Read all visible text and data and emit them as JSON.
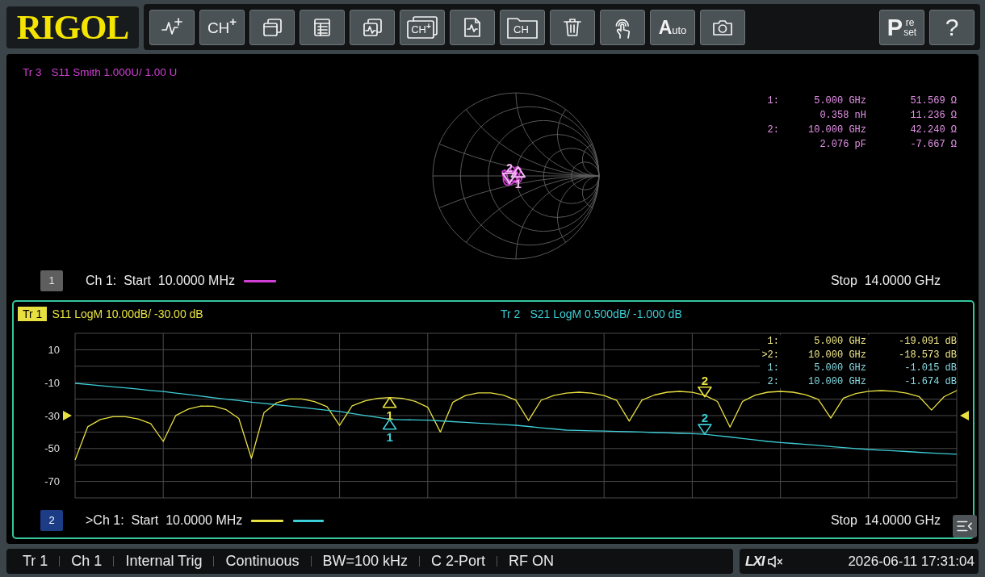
{
  "logo": {
    "text": "RIGOL"
  },
  "toolbar": {
    "left": [
      {
        "kind": "icon"
      },
      {
        "kind": "text",
        "label": "CH$^{+}$"
      },
      {
        "kind": "icon"
      },
      {
        "kind": "icon"
      },
      {
        "kind": "icon"
      },
      {
        "kind": "icon_text",
        "label": "CH$^{+}$"
      },
      {
        "kind": "icon"
      },
      {
        "kind": "icon_text",
        "label": "CH"
      },
      {
        "kind": "icon"
      },
      {
        "kind": "icon"
      },
      {
        "kind": "initial",
        "label": "Auto"
      },
      {
        "kind": "icon"
      }
    ],
    "right": [
      {
        "kind": "stacked",
        "initial": "P",
        "lines": [
          "re",
          "set"
        ]
      },
      {
        "kind": "text",
        "label": "?"
      }
    ]
  },
  "upper": {
    "selected": false,
    "window": "1",
    "traces": [
      {
        "label": "Tr 3",
        "description": "S11 Smith 1.000U/ 1.00 U",
        "color": "#d23fd6",
        "selected": false
      }
    ],
    "smith": {
      "markers": [
        {
          "label": "2"
        },
        {
          "label": "1"
        }
      ]
    },
    "markers": [
      {
        "marker": "1:",
        "reading_1": "5.000 GHz",
        "reading_2": "51.569 Ω"
      },
      {
        "reading_1": "0.358 nH",
        "reading_2": "11.236 Ω"
      },
      {
        "marker": "2:",
        "reading_1": "10.000 GHz",
        "reading_2": "42.240 Ω"
      },
      {
        "reading_1": "2.076 pF",
        "reading_2": "-7.667 Ω"
      }
    ],
    "footer": {
      "channel": "Ch 1:  Start  10.0000 MHz",
      "stop": "Stop  14.0000 GHz"
    }
  },
  "lower": {
    "selected": true,
    "window": "2",
    "traces": [
      {
        "label": "Tr 1",
        "description": "S11 LogM 10.00dB/ -30.00 dB",
        "color": "#e8e040",
        "selected": true,
        "chart_markers": [
          {
            "label": "1"
          },
          {
            "label": "2"
          }
        ]
      },
      {
        "label": "Tr 2",
        "description": "S21 LogM 0.500dB/ -1.000 dB",
        "color": "#3ccdd6",
        "selected": false,
        "chart_markers": [
          {
            "label": "1"
          },
          {
            "label": "2"
          }
        ]
      }
    ],
    "markers": [
      {
        "marker": "1:",
        "reading_1": "5.000 GHz",
        "reading_2": "-19.091 dB",
        "color": "#f1e98a"
      },
      {
        "marker": ">2:",
        "reading_1": "10.000 GHz",
        "reading_2": "-18.573 dB",
        "color": "#f1e98a"
      },
      {
        "marker": "1:",
        "reading_1": "5.000 GHz",
        "reading_2": "-1.015 dB",
        "color": "#88dce4"
      },
      {
        "marker": "2:",
        "reading_1": "10.000 GHz",
        "reading_2": "-1.674 dB",
        "color": "#88dce4"
      }
    ],
    "chart_data": {
      "type": "line",
      "grid": true,
      "categories": [
        null,
        null,
        null,
        null,
        null,
        null,
        null,
        null,
        null,
        null,
        null,
        null,
        null,
        null,
        null,
        null,
        null,
        null,
        null,
        null,
        null,
        null,
        null,
        null,
        null,
        null,
        null,
        null,
        null,
        null,
        null,
        null,
        null,
        null,
        null,
        null,
        null,
        null,
        null,
        null,
        null,
        null,
        null,
        null,
        null,
        null,
        null,
        null,
        null,
        null,
        null,
        null,
        null,
        null,
        null,
        null,
        null,
        null,
        null,
        null,
        null,
        null,
        null,
        null,
        null,
        null,
        null,
        null,
        null,
        null,
        null
      ],
      "ylim": [
        -80,
        20
      ],
      "yticks": [
        {
          "value": 10,
          "label": "10"
        },
        {
          "value": -10,
          "label": "-10"
        },
        {
          "value": -30,
          "label": "-30"
        },
        {
          "value": -50,
          "label": "-50"
        },
        {
          "value": -70,
          "label": "-70"
        }
      ],
      "series": [
        {
          "color": "#e8e040",
          "values": [
            -57,
            -36.8,
            -32.4,
            -30.7,
            -30.7,
            -32.0,
            -34.8,
            -45.7,
            -29.9,
            -26.0,
            -24.2,
            -24.3,
            -26.4,
            -31.7,
            -56,
            -28.2,
            -22.2,
            -19.9,
            -19.9,
            -21.5,
            -24.5,
            -36,
            -24.0,
            -21.1,
            -19.5,
            -19,
            -19.5,
            -21.3,
            -24.9,
            -40,
            -21.8,
            -17.8,
            -16.2,
            -16.2,
            -17.6,
            -20.6,
            -33,
            -20.7,
            -17.8,
            -16.3,
            -15.8,
            -16.3,
            -17.8,
            -20.8,
            -33.4,
            -20.6,
            -17.5,
            -15.8,
            -15.3,
            -15.9,
            -17.7,
            -21.4,
            -37,
            -21.3,
            -17.6,
            -15.8,
            -15.3,
            -15.8,
            -17.3,
            -20.1,
            -31.5,
            -19.4,
            -16.6,
            -15.2,
            -14.8,
            -15.2,
            -16.3,
            -18.4,
            -26.6,
            -18.5,
            -14.8
          ]
        },
        {
          "color": "#3ccdd6",
          "values": [
            -10.4,
            -11.1,
            -11.8,
            -12.5,
            -13.2,
            -13.9,
            -14.7,
            -15.4,
            -16.3,
            -17.2,
            -18.2,
            -19.1,
            -20.0,
            -20.9,
            -21.8,
            -22.6,
            -23.4,
            -24.2,
            -25.0,
            -25.9,
            -26.7,
            -27.5,
            -28.7,
            -29.9,
            -31.1,
            -32.3,
            -32.5,
            -32.6,
            -32.8,
            -33.2,
            -33.7,
            -34.1,
            -34.6,
            -35.0,
            -35.5,
            -35.9,
            -36.6,
            -37.4,
            -38.1,
            -38.8,
            -39.0,
            -39.2,
            -39.4,
            -39.6,
            -39.8,
            -40.0,
            -40.3,
            -40.5,
            -40.8,
            -41.0,
            -41.3,
            -42.2,
            -43.0,
            -43.9,
            -44.8,
            -45.7,
            -46.3,
            -46.9,
            -47.5,
            -48.1,
            -48.8,
            -49.4,
            -50.0,
            -50.6,
            -51.0,
            -51.4,
            -51.8,
            -52.3,
            -52.7,
            -53.1,
            -53.5
          ]
        }
      ]
    },
    "footer": {
      "channel": ">Ch 1:  Start  10.0000 MHz",
      "stop": "Stop  14.0000 GHz"
    }
  },
  "status_bar": {
    "items": [
      "Tr 1",
      "Ch 1",
      "Internal Trig",
      "Continuous",
      "BW=100 kHz",
      "C 2-Port",
      "RF ON"
    ],
    "logo": "LXI",
    "muted": true,
    "datetime": "2026-06-11 17:31:04"
  }
}
